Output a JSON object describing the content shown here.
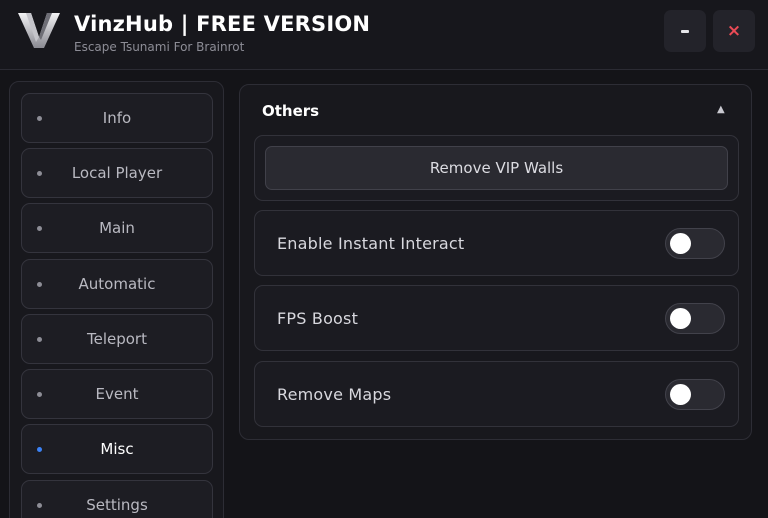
{
  "header": {
    "title": "VinzHub | FREE VERSION",
    "subtitle": "Escape Tsunami For Brainrot",
    "logo_icon": "vinzhub-v-logo-icon",
    "minimize_label": "-",
    "close_label": "×"
  },
  "sidebar": {
    "items": [
      {
        "label": "Info",
        "active": false
      },
      {
        "label": "Local Player",
        "active": false
      },
      {
        "label": "Main",
        "active": false
      },
      {
        "label": "Automatic",
        "active": false
      },
      {
        "label": "Teleport",
        "active": false
      },
      {
        "label": "Event",
        "active": false
      },
      {
        "label": "Misc",
        "active": true
      },
      {
        "label": "Settings",
        "active": false
      }
    ]
  },
  "section": {
    "title": "Others",
    "collapse_icon": "chevron-up-icon",
    "button_label": "Remove VIP Walls",
    "toggles": [
      {
        "label": "Enable Instant Interact",
        "on": false
      },
      {
        "label": "FPS Boost",
        "on": false
      },
      {
        "label": "Remove Maps",
        "on": false
      }
    ]
  },
  "colors": {
    "background": "#141418",
    "accent_active_dot": "#3b82f6",
    "close_icon": "#ea4b56"
  }
}
